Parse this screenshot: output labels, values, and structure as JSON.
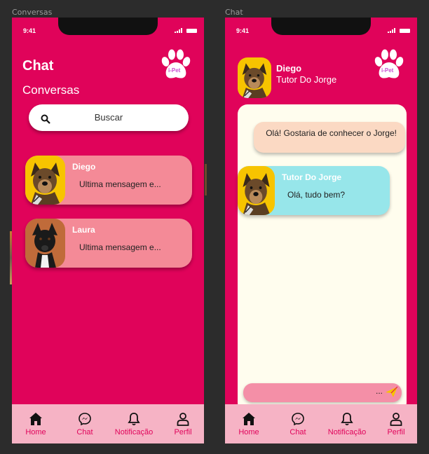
{
  "frames": {
    "left_label": "Conversas",
    "right_label": "Chat"
  },
  "status": {
    "time": "9:41"
  },
  "logo": {
    "text": "i-Pet"
  },
  "conversas": {
    "title": "Chat",
    "subtitle": "Conversas",
    "search_placeholder": "Buscar",
    "items": [
      {
        "name": "Diego",
        "message": "Ultima mensagem e..."
      },
      {
        "name": "Laura",
        "message": "Ultima mensagem e..."
      }
    ]
  },
  "chat": {
    "contact_name": "Diego",
    "contact_subtitle": "Tutor Do Jorge",
    "outgoing_message": "Olá! Gostaria de conhecer o Jorge!",
    "incoming_sender": "Tutor Do Jorge",
    "incoming_message": "Olá, tudo bem?",
    "input_value": "..."
  },
  "nav": {
    "items": [
      {
        "label": "Home",
        "icon": "home-icon"
      },
      {
        "label": "Chat",
        "icon": "messenger-icon"
      },
      {
        "label": "Notificação",
        "icon": "bell-icon"
      },
      {
        "label": "Perfil",
        "icon": "user-icon"
      }
    ]
  },
  "colors": {
    "primary": "#e0035a",
    "card": "#f48a97",
    "nav": "#f6b3c5",
    "chat_bg": "#fffdee",
    "incoming": "#97e6ea",
    "outgoing": "#fbd9c3"
  }
}
